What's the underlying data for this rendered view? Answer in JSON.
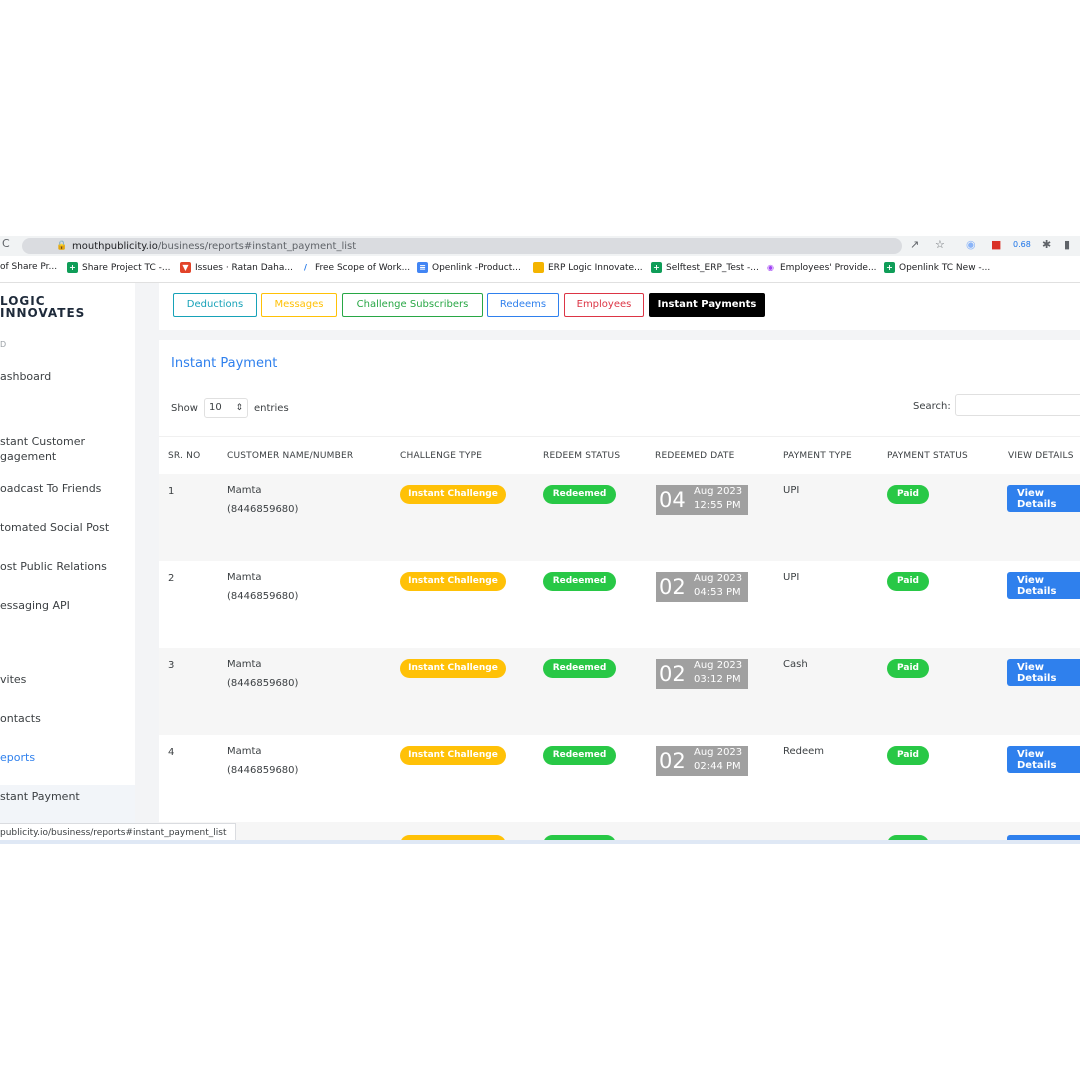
{
  "browser": {
    "url_host": "mouthpublicity.io",
    "url_path": "/business/reports#instant_payment_list",
    "zoom_badge": "0.68",
    "bookmarks": [
      {
        "label": "of Share Pr...",
        "icon": "none"
      },
      {
        "label": "Share Project TC -...",
        "icon": "sheets-icon"
      },
      {
        "label": "Issues · Ratan Daha...",
        "icon": "gitlab-icon"
      },
      {
        "label": "Free Scope of Work...",
        "icon": "feather-icon"
      },
      {
        "label": "Openlink -Product...",
        "icon": "docs-icon"
      },
      {
        "label": "ERP Logic Innovate...",
        "icon": "folder-icon"
      },
      {
        "label": "Selftest_ERP_Test -...",
        "icon": "sheets-icon"
      },
      {
        "label": "Employees' Provide...",
        "icon": "globe-icon"
      },
      {
        "label": "Openlink TC New -...",
        "icon": "sheets-icon"
      }
    ]
  },
  "sidebar": {
    "logo_line1": "LOGIC",
    "logo_line2": "INNOVATES",
    "section_label": "D",
    "items": [
      {
        "label": "ashboard"
      },
      {
        "label": "stant Customer"
      },
      {
        "label": "gagement"
      },
      {
        "label": "oadcast To Friends"
      },
      {
        "label": "tomated Social Post"
      },
      {
        "label": "ost Public Relations"
      },
      {
        "label": "essaging API"
      },
      {
        "label": "vites"
      },
      {
        "label": "ontacts"
      },
      {
        "label": "eports"
      },
      {
        "label": "stant Payment"
      }
    ]
  },
  "status_bar": "publicity.io/business/reports#instant_payment_list",
  "tabs": [
    {
      "label": "Deductions",
      "color": "#17a2b8"
    },
    {
      "label": "Messages",
      "color": "#ffc107"
    },
    {
      "label": "Challenge Subscribers",
      "color": "#28a745"
    },
    {
      "label": "Redeems",
      "color": "#2f80ed"
    },
    {
      "label": "Employees",
      "color": "#dc3545"
    },
    {
      "label": "Instant Payments",
      "color": "#000000"
    }
  ],
  "card": {
    "title": "Instant Payment",
    "show_label": "Show",
    "entries_value": "10",
    "entries_label": "entries",
    "search_label": "Search:"
  },
  "table": {
    "headers": [
      "SR. NO",
      "CUSTOMER NAME/NUMBER",
      "CHALLENGE TYPE",
      "REDEEM STATUS",
      "REDEEMED DATE",
      "PAYMENT TYPE",
      "PAYMENT STATUS",
      "VIEW DETAILS"
    ],
    "rows": [
      {
        "sr": "1",
        "name": "Mamta",
        "number": "(8446859680)",
        "challenge": "Instant Challenge",
        "redeem": "Redeemed",
        "day": "04",
        "month": "Aug 2023",
        "time": "12:55 PM",
        "payment_type": "UPI",
        "payment_status": "Paid",
        "button": "View Details"
      },
      {
        "sr": "2",
        "name": "Mamta",
        "number": "(8446859680)",
        "challenge": "Instant Challenge",
        "redeem": "Redeemed",
        "day": "02",
        "month": "Aug 2023",
        "time": "04:53 PM",
        "payment_type": "UPI",
        "payment_status": "Paid",
        "button": "View Details"
      },
      {
        "sr": "3",
        "name": "Mamta",
        "number": "(8446859680)",
        "challenge": "Instant Challenge",
        "redeem": "Redeemed",
        "day": "02",
        "month": "Aug 2023",
        "time": "03:12 PM",
        "payment_type": "Cash",
        "payment_status": "Paid",
        "button": "View Details"
      },
      {
        "sr": "4",
        "name": "Mamta",
        "number": "(8446859680)",
        "challenge": "Instant Challenge",
        "redeem": "Redeemed",
        "day": "02",
        "month": "Aug 2023",
        "time": "02:44 PM",
        "payment_type": "Redeem",
        "payment_status": "Paid",
        "button": "View Details"
      }
    ]
  }
}
